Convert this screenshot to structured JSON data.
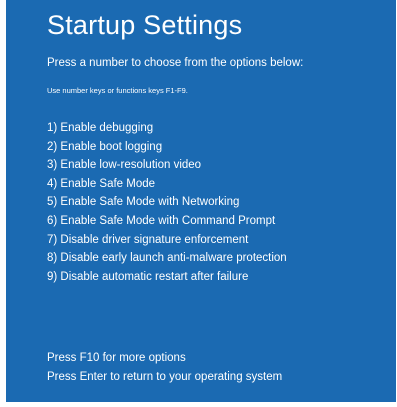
{
  "screen": {
    "title": "Startup Settings",
    "subtitle": "Press a number to choose from the options below:",
    "hint": "Use number keys or functions keys F1-F9.",
    "background_color": "#1b6ab2",
    "text_color": "#ffffff"
  },
  "options": [
    "1) Enable debugging",
    "2) Enable boot logging",
    "3) Enable low-resolution video",
    "4) Enable Safe Mode",
    "5) Enable Safe Mode with Networking",
    "6) Enable Safe Mode with Command Prompt",
    "7) Disable driver signature enforcement",
    "8) Disable early launch anti-malware protection",
    "9) Disable automatic restart after failure"
  ],
  "footer": {
    "more_options": "Press F10 for more options",
    "return": "Press Enter to return to your operating system"
  }
}
